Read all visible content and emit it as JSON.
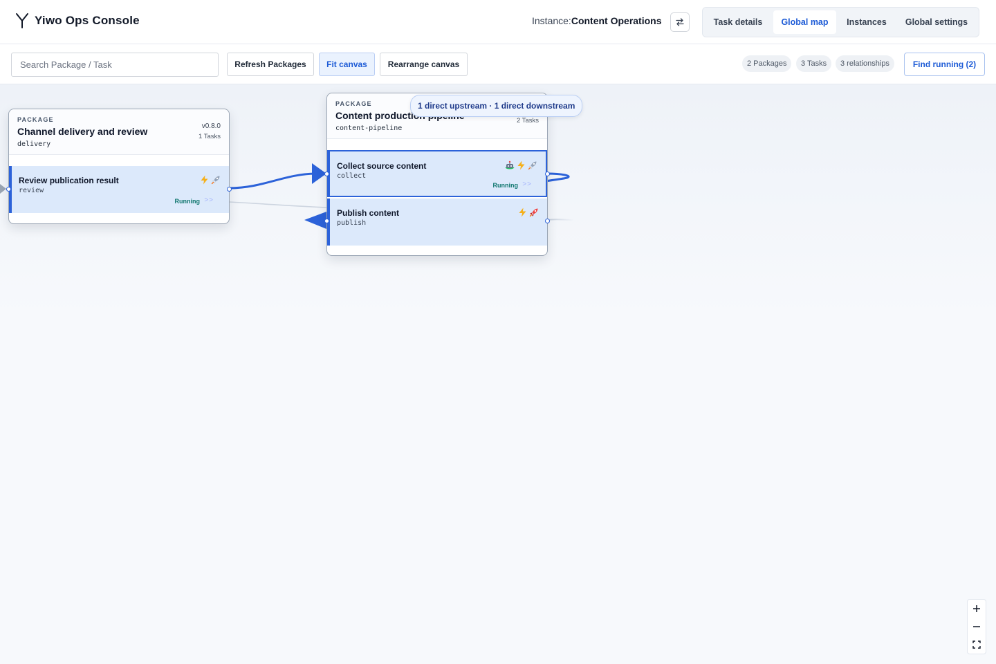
{
  "app": {
    "title": "Yiwo Ops Console"
  },
  "instance": {
    "label": "Instance:",
    "name": "Content Operations"
  },
  "nav": {
    "tabs": [
      {
        "label": "Task details"
      },
      {
        "label": "Global map",
        "active": true
      },
      {
        "label": "Instances"
      },
      {
        "label": "Global settings"
      }
    ]
  },
  "toolbar": {
    "search_placeholder": "Search Package / Task",
    "refresh_label": "Refresh Packages",
    "fit_label": "Fit canvas",
    "rearrange_label": "Rearrange canvas",
    "stats": {
      "packages": "2 Packages",
      "tasks": "3 Tasks",
      "relationships": "3 relationships"
    },
    "find_running_label": "Find running (2)"
  },
  "packages": [
    {
      "kind": "PACKAGE",
      "name": "Channel delivery and review",
      "id": "delivery",
      "version": "v0.8.0",
      "task_count": "1 Tasks",
      "tasks": [
        {
          "name": "Review publication result",
          "id": "review",
          "status": "Running",
          "icons": [
            "bolt-icon",
            "rocket-icon"
          ]
        }
      ]
    },
    {
      "kind": "PACKAGE",
      "name": "Content production pipeline",
      "id": "content-pipeline",
      "task_count": "2 Tasks",
      "tasks": [
        {
          "name": "Collect source content",
          "id": "collect",
          "status": "Running",
          "icons": [
            "robot-icon",
            "bolt-icon",
            "rocket-icon"
          ]
        },
        {
          "name": "Publish content",
          "id": "publish",
          "status": "",
          "icons": [
            "bolt-icon",
            "rocket-icon"
          ]
        }
      ]
    }
  ],
  "tooltip": {
    "text": "1 direct upstream · 1 direct downstream"
  },
  "colors": {
    "accent": "#2c62d9",
    "running": "#0f766e",
    "task_bg": "#dce9fb"
  }
}
